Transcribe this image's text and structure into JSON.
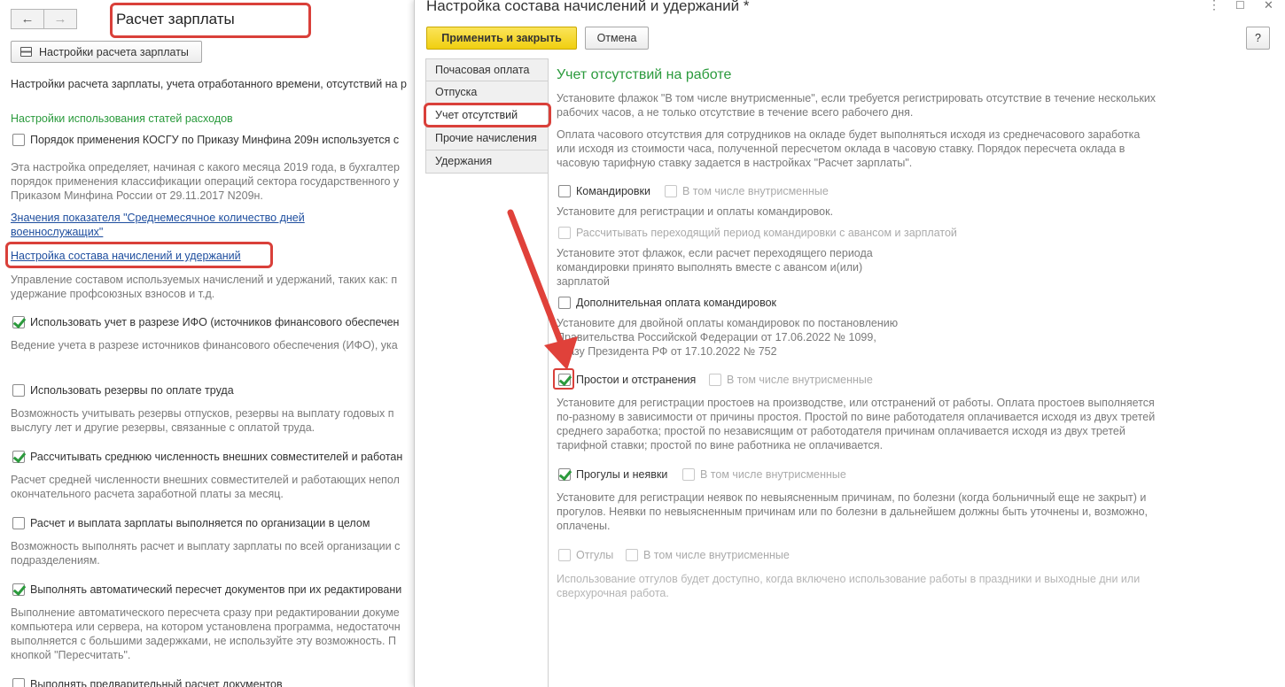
{
  "left": {
    "title": "Расчет зарплаты",
    "back_icon": "←",
    "forward_icon": "→",
    "settings_button": "Настройки расчета зарплаты",
    "intro": "Настройки расчета зарплаты, учета отработанного времени, отсутствий на р",
    "section_title": "Настройки использования статей расходов",
    "kosgu_label": "Порядок применения КОСГУ по Приказу Минфина 209н используется с",
    "kosgu_desc": [
      "Эта настройка определяет, начиная с какого месяца 2019 года, в бухгалтер",
      "порядок применения классификации операций сектора государственного у",
      "Приказом Минфина России от 29.11.2017 N209н."
    ],
    "link1": [
      "Значения показателя \"Среднемесячное количество дней",
      "военнослужащих\""
    ],
    "link2": "Настройка состава начислений и удержаний",
    "link2_desc": [
      "Управление составом используемых начислений и удержаний, таких как: п",
      "удержание профсоюзных взносов и т.д."
    ],
    "ifo_label": "Использовать учет в разрезе ИФО (источников финансового обеспечен",
    "ifo_desc": "Ведение учета в разрезе источников финансового обеспечения (ИФО), ука",
    "reserve_label": "Использовать резервы по оплате труда",
    "reserve_desc": [
      "Возможность учитывать резервы отпусков,  резервы на выплату годовых п",
      "выслугу лет и другие резервы, связанные с оплатой труда."
    ],
    "avg_label": "Рассчитывать среднюю численность внешних совместителей и работан",
    "avg_desc": [
      "Расчет средней численности внешних совместителей и работающих непол",
      "окончательного расчета заработной платы за месяц."
    ],
    "org_label": "Расчет и выплата зарплаты выполняется по организации в целом",
    "org_desc": [
      "Возможность выполнять расчет и выплату зарплаты по всей организации с",
      "подразделениям."
    ],
    "auto_label": "Выполнять автоматический пересчет документов при их редактировани",
    "auto_desc": [
      "Выполнение автоматического пересчета сразу при редактировании докуме",
      "компьютера или сервера, на котором установлена программа, недостаточн",
      "выполняется с большими задержками, не используйте эту возможность. П",
      "кнопкой \"Пересчитать\"."
    ],
    "pre_label": "Выполнять предварительный расчет документов"
  },
  "dialog": {
    "title": "Настройка состава начислений и удержаний *",
    "apply_button": "Применить и закрыть",
    "cancel_button": "Отмена",
    "help_button": "?",
    "more_icon": "⋮",
    "maximize_icon": "☐",
    "close_icon": "✕",
    "tabs": [
      "Почасовая оплата",
      "Отпуска",
      "Учет отсутствий",
      "Прочие начисления",
      "Удержания"
    ],
    "section_title": "Учет отсутствий на работе",
    "p1": [
      "Установите флажок \"В том числе внутрисменные\", если требуется регистрировать отсутствие в течение нескольких",
      "рабочих часов, а не только отсутствие в течение всего рабочего дня."
    ],
    "p2": [
      "Оплата часового отсутствия для сотрудников на окладе будет выполняться исходя из среднечасового заработка",
      "или исходя из стоимости часа, полученной пересчетом оклада в часовую ставку. Порядок пересчета оклада в",
      "часовую тарифную ставку задается в настройках \"Расчет зарплаты\"."
    ],
    "trips_label": "Командировки",
    "intra_label": "В том числе внутрисменные",
    "trips_desc": "Установите для регистрации и оплаты командировок.",
    "rollover_label": "Рассчитывать переходящий период командировки с авансом и зарплатой",
    "rollover_desc": [
      "Установите этот флажок, если расчет переходящего периода",
      "командировки принято выполнять вместе с авансом и(или)",
      "зарплатой"
    ],
    "extra_label": "Дополнительная оплата командировок",
    "extra_desc": [
      "Установите для двойной оплаты командировок по постановлению",
      "Правительства Российской Федерации от 17.06.2022 № 1099,",
      "Указу Президента РФ от 17.10.2022 № 752"
    ],
    "idle_label": "Простои и отстранения",
    "idle_desc": [
      "Установите для регистрации простоев на производстве, или отстранений от работы. Оплата простоев выполняется",
      "по-разному в зависимости от причины простоя. Простой по вине работодателя оплачивается исходя из двух третей",
      "среднего заработка; простой по независящим от работодателя причинам оплачивается исходя из двух третей",
      "тарифной ставки; простой по вине работника не оплачивается."
    ],
    "absence_label": "Прогулы и неявки",
    "absence_desc": [
      "Установите для регистрации неявок по невыясненным причинам, по болезни (когда больничный еще не закрыт) и",
      "прогулов. Неявки по невыясненным причинам или по болезни в дальнейшем должны быть уточнены и, возможно,",
      "оплачены."
    ],
    "timeoff_label": "Отгулы",
    "timeoff_desc": [
      "Использование отгулов будет доступно, когда включено использование работы в праздники и выходные дни или",
      "сверхурочная работа."
    ]
  }
}
